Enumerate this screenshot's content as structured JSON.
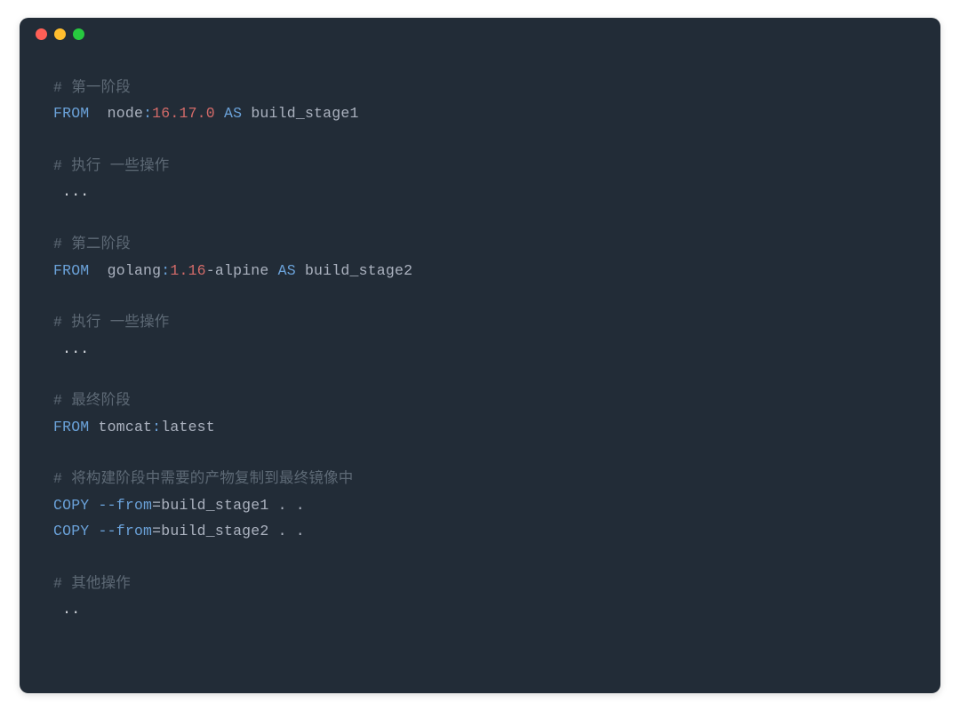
{
  "colors": {
    "bg": "#222c37",
    "comment": "#5d6975",
    "keyword": "#6aa1d8",
    "text": "#abb2bf",
    "string": "#98c379",
    "number": "#d46b69",
    "white": "#d7dae0",
    "dot_red": "#ff5f56",
    "dot_yellow": "#ffbd2e",
    "dot_green": "#27c93f"
  },
  "tokens": {
    "c1": "# 第一阶段",
    "l2_from": "FROM",
    "l2_sp1": "  ",
    "l2_node": "node",
    "l2_colon": ":",
    "l2_ver": "16.17.0",
    "l2_sp2": " ",
    "l2_as": "AS",
    "l2_sp3": " ",
    "l2_stage": "build_stage1",
    "c2": "# 执行 一些操作",
    "l5_dots": " ...",
    "c3": "# 第二阶段",
    "l8_from": "FROM",
    "l8_sp1": "  ",
    "l8_go": "golang",
    "l8_colon": ":",
    "l8_ver": "1.16",
    "l8_alp": "-alpine",
    "l8_sp2": " ",
    "l8_as": "AS",
    "l8_sp3": " ",
    "l8_stage": "build_stage2",
    "c4": "# 执行 一些操作",
    "l11_dots": " ...",
    "c5": "# 最终阶段",
    "l14_from": "FROM",
    "l14_sp": " ",
    "l14_tom": "tomcat",
    "l14_colon": ":",
    "l14_lat": "latest",
    "c6": "# 将构建阶段中需要的产物复制到最终镜像中",
    "l17_copy": "COPY",
    "l17_sp": " ",
    "l17_flag": "--from",
    "l17_eq": "=build_stage1 . .",
    "l18_copy": "COPY",
    "l18_sp": " ",
    "l18_flag": "--from",
    "l18_eq": "=build_stage2 . .",
    "c7": "# 其他操作",
    "l21_dots": " .."
  }
}
